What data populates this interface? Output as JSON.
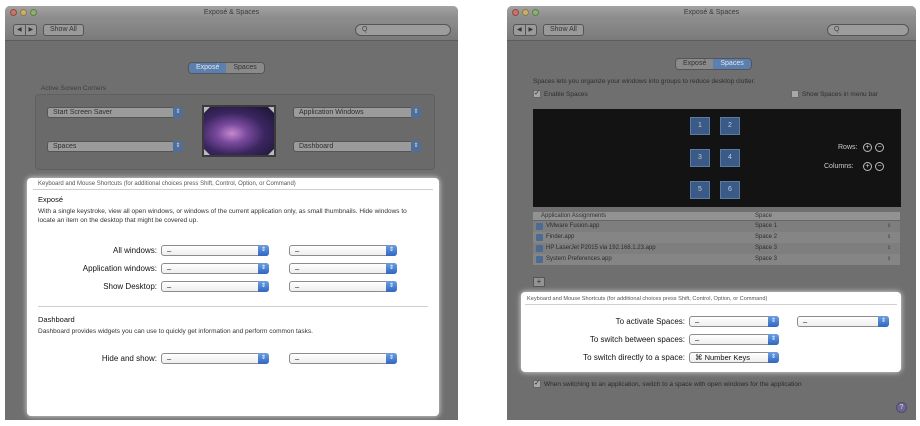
{
  "left_window": {
    "title": "Exposé & Spaces",
    "show_all": "Show All",
    "search_placeholder": "Q",
    "tabs": [
      "Exposé",
      "Spaces"
    ],
    "active_screen_corners": {
      "label": "Active Screen Corners",
      "top_left": "Start Screen Saver",
      "bottom_left": "Spaces",
      "top_right": "Application Windows",
      "bottom_right": "Dashboard"
    },
    "shortcuts_header": "Keyboard and Mouse Shortcuts (for additional choices press Shift, Control, Option, or Command)",
    "expose": {
      "title": "Exposé",
      "description": "With a single keystroke, view all open windows, or windows of the current application only, as small thumbnails. Hide windows to locate an item on the desktop that might be covered up.",
      "rows": [
        {
          "label": "All windows:",
          "key": "–",
          "mouse": "–"
        },
        {
          "label": "Application windows:",
          "key": "–",
          "mouse": "–"
        },
        {
          "label": "Show Desktop:",
          "key": "–",
          "mouse": "–"
        }
      ]
    },
    "dashboard": {
      "title": "Dashboard",
      "description": "Dashboard provides widgets you can use to quickly get information and perform common tasks.",
      "row": {
        "label": "Hide and show:",
        "key": "–",
        "mouse": "–"
      }
    }
  },
  "right_window": {
    "title": "Exposé & Spaces",
    "show_all": "Show All",
    "search_placeholder": "Q",
    "tabs": [
      "Exposé",
      "Spaces"
    ],
    "intro": "Spaces lets you organize your windows into groups to reduce desktop clutter.",
    "enable_spaces": "Enable Spaces",
    "show_in_menu_bar": "Show Spaces in menu bar",
    "spaces": [
      "1",
      "2",
      "3",
      "4",
      "5",
      "6"
    ],
    "rows_label": "Rows:",
    "columns_label": "Columns:",
    "plus": "+",
    "minus": "−",
    "table_headers": [
      "Application Assignments",
      "Space"
    ],
    "assignments": [
      {
        "app": "VMware Fusion.app",
        "space": "Space 1"
      },
      {
        "app": "Finder.app",
        "space": "Space 2"
      },
      {
        "app": "HP LaserJet P2015 via 192.168.1.23.app",
        "space": "Space 3"
      },
      {
        "app": "System Preferences.app",
        "space": "Space 3"
      }
    ],
    "add_button": "+",
    "shortcuts_header": "Keyboard and Mouse Shortcuts (for additional choices press Shift, Control, Option, or Command)",
    "shortcuts": [
      {
        "label": "To activate Spaces:",
        "key": "–",
        "mouse": "–"
      },
      {
        "label": "To switch between spaces:",
        "key": "–"
      },
      {
        "label": "To switch directly to a space:",
        "key": "⌘ Number Keys"
      }
    ],
    "switch_option": "When switching to an application, switch to a space with open windows for the application",
    "help": "?"
  }
}
